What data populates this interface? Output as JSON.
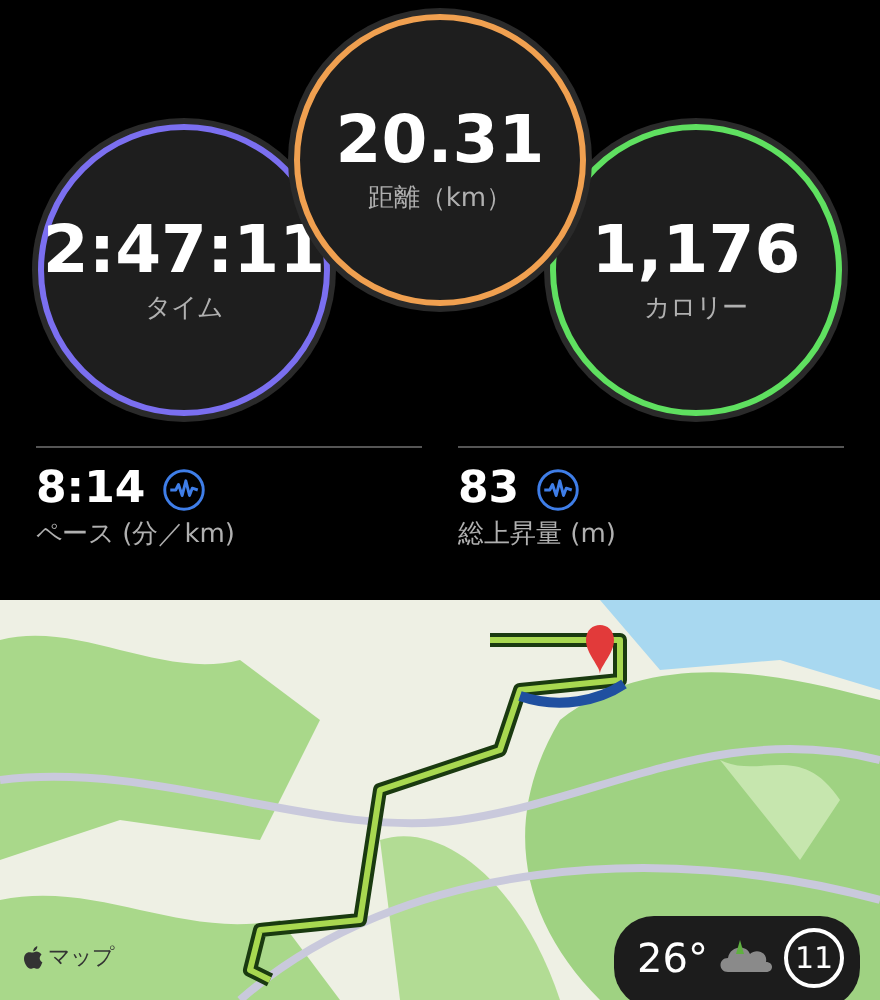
{
  "rings": [
    {
      "value": "2:47:11",
      "label": "タイム",
      "color": "#7b6ff0"
    },
    {
      "value": "20.31",
      "label": "距離（km）",
      "color": "#f0a050"
    },
    {
      "value": "1,176",
      "label": "カロリー",
      "color": "#5fe060"
    }
  ],
  "metrics": [
    {
      "value": "8:14",
      "label": "ペース (分／km)"
    },
    {
      "value": "83",
      "label": "総上昇量 (m)"
    }
  ],
  "map": {
    "attribution": "マップ",
    "weather": {
      "temperature": "26°",
      "index": "11"
    }
  }
}
